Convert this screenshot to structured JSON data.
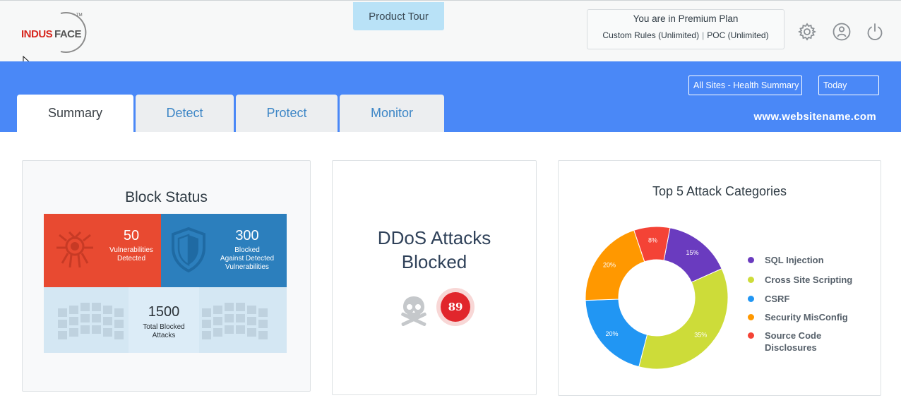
{
  "header": {
    "logo_text": "INDUSFACE",
    "logo_mark": "TM",
    "product_tour_label": "Product Tour",
    "plan_title": "You are in Premium Plan",
    "plan_custom_rules": "Custom Rules (Unlimited)",
    "plan_poc": "POC (Unlimited)",
    "icons": [
      "gear-icon",
      "user-icon",
      "power-icon"
    ]
  },
  "nav": {
    "tabs": [
      {
        "label": "Summary",
        "active": true
      },
      {
        "label": "Detect",
        "active": false
      },
      {
        "label": "Protect",
        "active": false
      },
      {
        "label": "Monitor",
        "active": false
      }
    ],
    "site_selector": "All Sites - Health Summary",
    "period_selector": "Today",
    "site_name": "www.websitename.com"
  },
  "block_status": {
    "title": "Block Status",
    "vulnerabilities": {
      "count": "50",
      "label_line1": "Vulnerabilities",
      "label_line2": "Detected"
    },
    "blocked": {
      "count": "300",
      "label_line1": "Blocked",
      "label_line2": "Against Detected",
      "label_line3": "Vulnerabilities"
    },
    "total": {
      "count": "1500",
      "label_line1": "Total Blocked",
      "label_line2": "Attacks"
    }
  },
  "ddos": {
    "title_line1": "DDoS Attacks",
    "title_line2": "Blocked",
    "count": "89"
  },
  "colors": {
    "brand_blue": "#4a88f7",
    "red": "#e84a31",
    "shield_blue": "#2c7fbd",
    "badge_red": "#e1262c"
  },
  "attack_categories": {
    "title": "Top 5 Attack Categories",
    "chart_data": {
      "type": "pie",
      "donut": true,
      "title": "Top 5 Attack Categories",
      "series": [
        {
          "name": "SQL Injection",
          "value": 15,
          "label": "15%",
          "color": "#6a3bbf"
        },
        {
          "name": "Cross Site Scripting",
          "value": 35,
          "label": "35%",
          "color": "#cddc39"
        },
        {
          "name": "CSRF",
          "value": 20,
          "label": "20%",
          "color": "#2196f3"
        },
        {
          "name": "Security MisConfig",
          "value": 20,
          "label": "20%",
          "color": "#ff9800"
        },
        {
          "name": "Source Code Disclosures",
          "value": 8,
          "label": "8%",
          "color": "#f44336"
        }
      ],
      "legend_position": "right"
    }
  }
}
